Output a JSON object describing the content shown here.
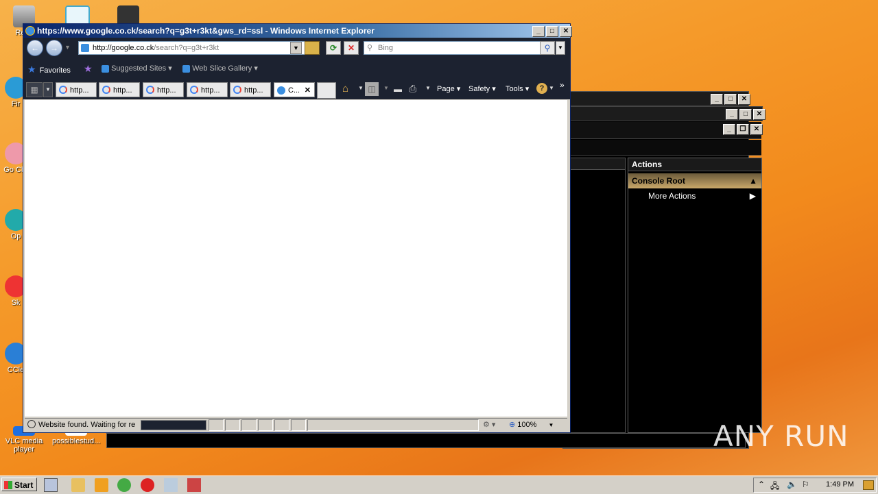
{
  "desktop": {
    "icons": [
      {
        "label": "Recy",
        "name": "recycle-bin"
      },
      {
        "label": "Fir",
        "name": "firefox"
      },
      {
        "label": "Go Chr",
        "name": "google-chrome"
      },
      {
        "label": "Op",
        "name": "opera"
      },
      {
        "label": "Sk",
        "name": "skype"
      },
      {
        "label": "CCle",
        "name": "ccleaner"
      },
      {
        "label": "VLC media player",
        "name": "vlc"
      },
      {
        "label": "possiblestud...",
        "name": "word-doc"
      }
    ]
  },
  "ie": {
    "title": "https://www.google.co.ck/search?q=g3t+r3kt&gws_rd=ssl - Windows Internet Explorer",
    "address": {
      "host": "http://google.co.ck",
      "path": "/search?q=g3t+r3kt"
    },
    "search_placeholder": "Bing",
    "favbar": {
      "favorites": "Favorites",
      "suggested": "Suggested Sites",
      "webslice": "Web Slice Gallery"
    },
    "tabs": [
      "http...",
      "http...",
      "http...",
      "http...",
      "http...",
      "C..."
    ],
    "commands": {
      "page": "Page",
      "safety": "Safety",
      "tools": "Tools"
    },
    "status": {
      "text": "Website found. Waiting for re",
      "zoom": "100%"
    }
  },
  "mmc": {
    "actions_header": "Actions",
    "console_root": "Console Root",
    "more_actions": "More Actions"
  },
  "taskbar": {
    "start": "Start",
    "clock": "1:49 PM"
  },
  "watermark": "ANY RUN"
}
